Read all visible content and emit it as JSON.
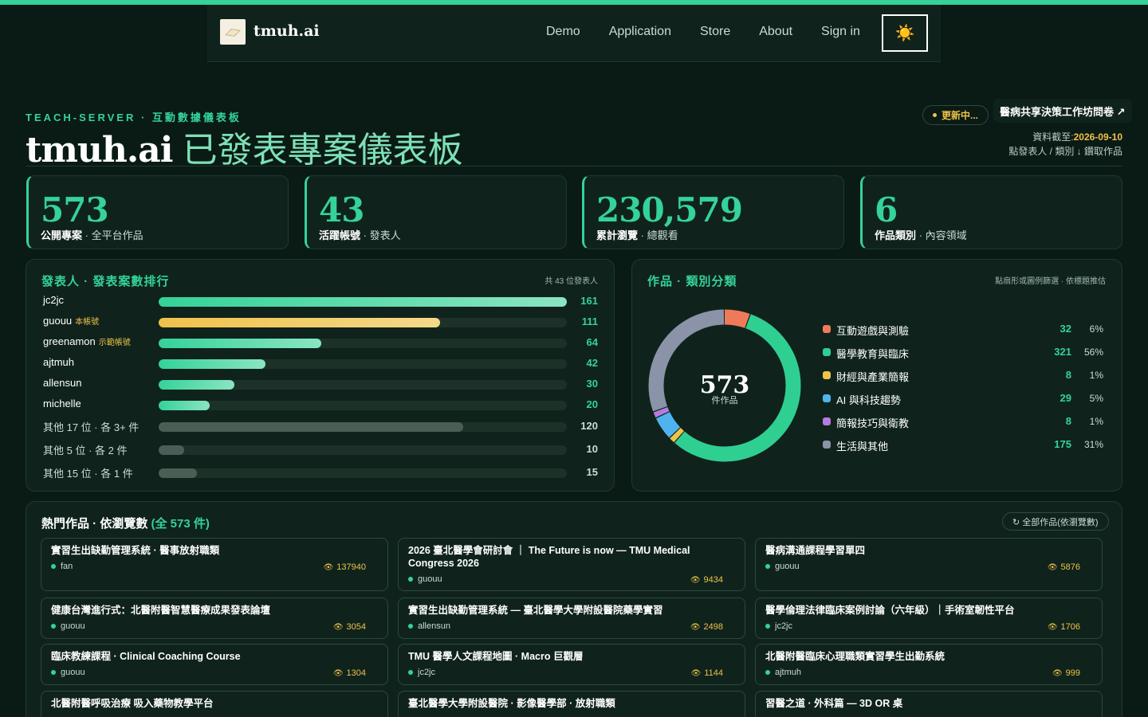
{
  "nav": {
    "brand": "tmuh.ai",
    "links": [
      "Demo",
      "Application",
      "Store",
      "About",
      "Sign in"
    ],
    "theme_icon": "☀️"
  },
  "header": {
    "eyebrow": "TEACH-SERVER · 互動數據儀表板",
    "title_brand": "tmuh.ai",
    "title_rest": "已發表專案儀表板",
    "update_status": "更新中...",
    "survey_link": "醫病共享決策工作坊問卷 ↗",
    "asof_label": "資料截至:",
    "asof_date": "2026-09-10",
    "hint": "點發表人 / 類別 ↓ 鑽取作品"
  },
  "stats": [
    {
      "value": "573",
      "label_strong": "公開專案",
      "label_rest": " · 全平台作品"
    },
    {
      "value": "43",
      "label_strong": "活躍帳號",
      "label_rest": " · 發表人"
    },
    {
      "value": "230,579",
      "label_strong": "累計瀏覽",
      "label_rest": " · 總觀看"
    },
    {
      "value": "6",
      "label_strong": "作品類別",
      "label_rest": " · 內容領域"
    }
  ],
  "ranking": {
    "title": "發表人 · 發表案數排行",
    "note": "共 43 位發表人",
    "max": 161,
    "rows": [
      {
        "name": "jc2jc",
        "tag": "",
        "value": 161,
        "kind": "top"
      },
      {
        "name": "guouu",
        "tag": "本帳號",
        "value": 111,
        "kind": "self"
      },
      {
        "name": "greenamon",
        "tag": "示範帳號",
        "value": 64,
        "kind": "top"
      },
      {
        "name": "ajtmuh",
        "tag": "",
        "value": 42,
        "kind": "top"
      },
      {
        "name": "allensun",
        "tag": "",
        "value": 30,
        "kind": "top"
      },
      {
        "name": "michelle",
        "tag": "",
        "value": 20,
        "kind": "top"
      },
      {
        "name": "其他 17 位 · 各 3+ 件",
        "tag": "",
        "value": 120,
        "kind": "other"
      },
      {
        "name": "其他 5 位 · 各 2 件",
        "tag": "",
        "value": 10,
        "kind": "other"
      },
      {
        "name": "其他 15 位 · 各 1 件",
        "tag": "",
        "value": 15,
        "kind": "other"
      }
    ]
  },
  "categories": {
    "title": "作品 · 類別分類",
    "note": "點扇形或圖例篩選 · 依標題推估",
    "total": "573",
    "total_label": "件作品",
    "items": [
      {
        "name": "互動遊戲與測驗",
        "count": 32,
        "pct": "6%",
        "color": "#ef7a5a"
      },
      {
        "name": "醫學教育與臨床",
        "count": 321,
        "pct": "56%",
        "color": "#2fcf92"
      },
      {
        "name": "財經與產業簡報",
        "count": 8,
        "pct": "1%",
        "color": "#f0c24a"
      },
      {
        "name": "AI 與科技趨勢",
        "count": 29,
        "pct": "5%",
        "color": "#4fb4ee"
      },
      {
        "name": "簡報技巧與衛教",
        "count": 8,
        "pct": "1%",
        "color": "#b57be0"
      },
      {
        "name": "生活與其他",
        "count": 175,
        "pct": "31%",
        "color": "#8a93a8"
      }
    ]
  },
  "popular": {
    "title": "熱門作品 · 依瀏覽數",
    "title_count": "(全 573 件)",
    "all_button": "↻ 全部作品(依瀏覽數)",
    "items": [
      {
        "title": "實習生出缺勤管理系統 · 醫事放射職類",
        "author": "fan",
        "views": "137940"
      },
      {
        "title": "2026 臺北醫學會研討會 ｜ The Future is now — TMU Medical Congress 2026",
        "author": "guouu",
        "views": "9434"
      },
      {
        "title": "醫病溝通課程學習單四",
        "author": "guouu",
        "views": "5876"
      },
      {
        "title": "健康台灣進行式：北醫附醫智慧醫療成果發表論壇",
        "author": "guouu",
        "views": "3054"
      },
      {
        "title": "實習生出缺勤管理系統 — 臺北醫學大學附設醫院藥學實習",
        "author": "allensun",
        "views": "2498"
      },
      {
        "title": "醫學倫理法律臨床案例討論（六年級）｜手術室韌性平台",
        "author": "jc2jc",
        "views": "1706"
      },
      {
        "title": "臨床教練課程 · Clinical Coaching Course",
        "author": "guouu",
        "views": "1304"
      },
      {
        "title": "TMU 醫學人文課程地圖 · Macro 巨觀層",
        "author": "jc2jc",
        "views": "1144"
      },
      {
        "title": "北醫附醫臨床心理職類實習學生出勤系統",
        "author": "ajtmuh",
        "views": "999"
      },
      {
        "title": "北醫附醫呼吸治療 吸入藥物教學平台",
        "author": "",
        "views": ""
      },
      {
        "title": "臺北醫學大學附設醫院 · 影像醫學部 · 放射職類",
        "author": "",
        "views": ""
      },
      {
        "title": "習醫之道 · 外科篇 — 3D OR 桌",
        "author": "",
        "views": ""
      }
    ]
  }
}
